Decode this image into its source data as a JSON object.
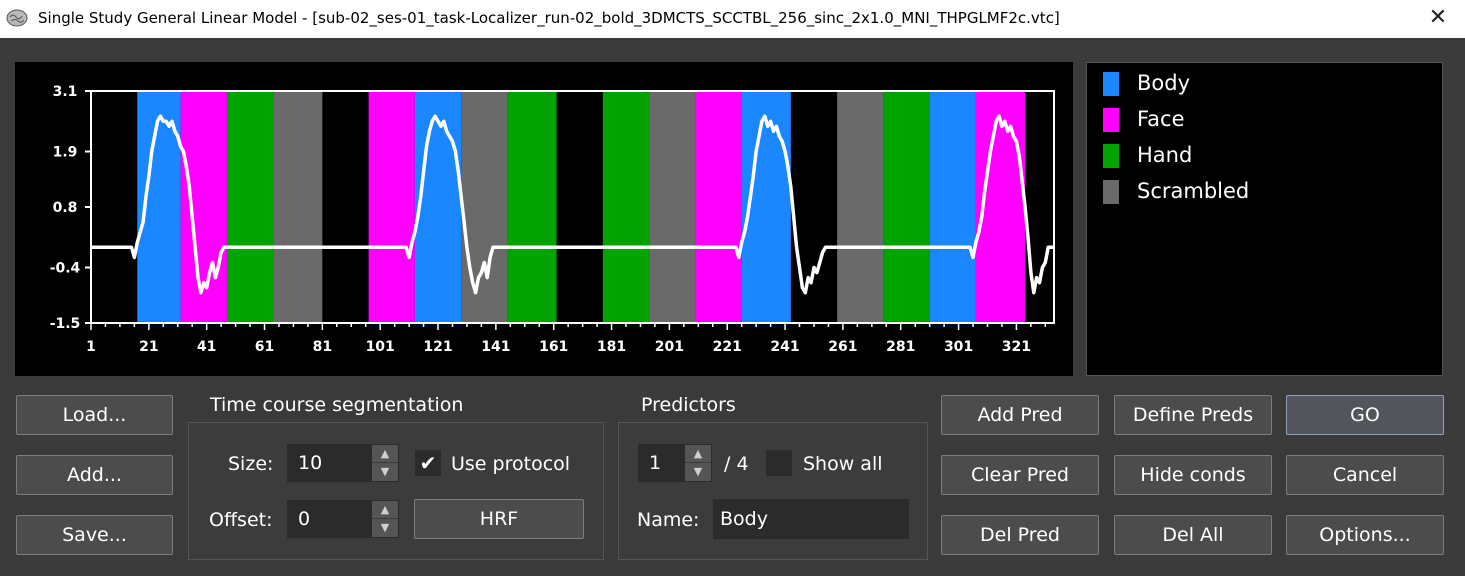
{
  "window": {
    "title": "Single Study General Linear Model - [sub-02_ses-01_task-Localizer_run-02_bold_3DMCTS_SCCTBL_256_sinc_2x1.0_MNI_THPGLMF2c.vtc]",
    "close_glyph": "✕"
  },
  "colors": {
    "Body": "#1a86ff",
    "Face": "#ff00ff",
    "Hand": "#00a300",
    "Scrambled": "#6a6a6a",
    "curve": "#ffffff"
  },
  "legend": [
    {
      "label": "Body",
      "color": "#1a86ff"
    },
    {
      "label": "Face",
      "color": "#ff00ff"
    },
    {
      "label": "Hand",
      "color": "#00a300"
    },
    {
      "label": "Scrambled",
      "color": "#6a6a6a"
    }
  ],
  "chart_data": {
    "type": "line",
    "xlim": [
      1,
      334
    ],
    "ylim": [
      -1.5,
      3.1
    ],
    "ytick_labels": [
      "3.1",
      "1.9",
      "0.8",
      "-0.4",
      "-1.5"
    ],
    "ytick_values": [
      3.1,
      1.9,
      0.8,
      -0.4,
      -1.5
    ],
    "xtick_labels": [
      "1",
      "21",
      "41",
      "61",
      "81",
      "101",
      "121",
      "141",
      "161",
      "181",
      "201",
      "221",
      "241",
      "261",
      "281",
      "301",
      "321"
    ],
    "xtick_values": [
      1,
      21,
      41,
      61,
      81,
      101,
      121,
      141,
      161,
      181,
      201,
      221,
      241,
      261,
      281,
      301,
      321
    ],
    "blocks": [
      {
        "cond": "Body",
        "start": 17,
        "end": 32
      },
      {
        "cond": "Face",
        "start": 32,
        "end": 48
      },
      {
        "cond": "Hand",
        "start": 48,
        "end": 64
      },
      {
        "cond": "Scrambled",
        "start": 64,
        "end": 81
      },
      {
        "cond": "Face",
        "start": 97,
        "end": 113
      },
      {
        "cond": "Body",
        "start": 113,
        "end": 129
      },
      {
        "cond": "Scrambled",
        "start": 129,
        "end": 145
      },
      {
        "cond": "Hand",
        "start": 145,
        "end": 162
      },
      {
        "cond": "Hand",
        "start": 178,
        "end": 194
      },
      {
        "cond": "Scrambled",
        "start": 194,
        "end": 210
      },
      {
        "cond": "Face",
        "start": 210,
        "end": 226
      },
      {
        "cond": "Body",
        "start": 226,
        "end": 243
      },
      {
        "cond": "Scrambled",
        "start": 259,
        "end": 275
      },
      {
        "cond": "Hand",
        "start": 275,
        "end": 291
      },
      {
        "cond": "Body",
        "start": 291,
        "end": 307
      },
      {
        "cond": "Face",
        "start": 307,
        "end": 324
      }
    ],
    "series": [
      {
        "x": [
          1,
          15,
          16,
          17,
          18,
          19,
          20,
          21,
          22,
          23,
          24,
          25,
          26,
          27,
          28,
          29,
          30,
          31,
          32,
          33,
          34,
          35,
          36,
          37,
          38,
          39,
          40,
          41,
          42,
          43,
          44,
          45,
          46,
          47,
          48,
          110,
          111,
          112,
          113,
          114,
          115,
          116,
          117,
          118,
          119,
          120,
          121,
          122,
          123,
          124,
          125,
          126,
          127,
          128,
          129,
          130,
          131,
          132,
          133,
          134,
          135,
          136,
          137,
          138,
          139,
          140,
          141,
          142,
          143,
          144,
          224,
          225,
          226,
          227,
          228,
          229,
          230,
          231,
          232,
          233,
          234,
          235,
          236,
          237,
          238,
          239,
          240,
          241,
          242,
          243,
          244,
          245,
          246,
          247,
          248,
          249,
          250,
          251,
          252,
          253,
          254,
          255,
          256,
          257,
          258,
          305,
          306,
          307,
          308,
          309,
          310,
          311,
          312,
          313,
          314,
          315,
          316,
          317,
          318,
          319,
          320,
          321,
          322,
          323,
          324,
          325,
          326,
          327,
          328,
          329,
          330,
          331,
          332,
          333,
          334
        ],
        "y": [
          0.0,
          0.0,
          -0.2,
          0.1,
          0.3,
          0.5,
          1.0,
          1.4,
          1.9,
          2.2,
          2.5,
          2.6,
          2.5,
          2.5,
          2.4,
          2.5,
          2.3,
          2.2,
          2.0,
          1.9,
          1.6,
          1.2,
          0.6,
          0.0,
          -0.6,
          -0.9,
          -0.7,
          -0.8,
          -0.5,
          -0.3,
          -0.6,
          -0.4,
          -0.1,
          0.0,
          0.0,
          0.0,
          -0.2,
          0.1,
          0.3,
          0.6,
          1.0,
          1.5,
          2.0,
          2.3,
          2.5,
          2.6,
          2.5,
          2.4,
          2.5,
          2.3,
          2.2,
          2.1,
          1.9,
          1.5,
          1.0,
          0.5,
          0.0,
          -0.4,
          -0.7,
          -0.9,
          -0.6,
          -0.5,
          -0.3,
          -0.6,
          -0.2,
          0.0,
          0.0,
          0.0,
          0.0,
          0.0,
          0.0,
          -0.2,
          0.1,
          0.3,
          0.6,
          1.0,
          1.4,
          1.9,
          2.2,
          2.5,
          2.6,
          2.4,
          2.5,
          2.3,
          2.4,
          2.2,
          2.1,
          1.9,
          1.6,
          1.2,
          0.6,
          0.0,
          -0.4,
          -0.8,
          -0.9,
          -0.6,
          -0.7,
          -0.4,
          -0.5,
          -0.3,
          -0.1,
          0.0,
          0.0,
          0.0,
          0.0,
          0.0,
          -0.2,
          0.1,
          0.3,
          0.6,
          1.1,
          1.5,
          1.9,
          2.2,
          2.5,
          2.6,
          2.4,
          2.5,
          2.3,
          2.4,
          2.2,
          2.1,
          1.8,
          1.3,
          0.8,
          0.2,
          -0.5,
          -0.9,
          -0.6,
          -0.7,
          -0.4,
          -0.3,
          0.0,
          0.0,
          0.0
        ]
      }
    ]
  },
  "buttons": {
    "load": "Load...",
    "add": "Add...",
    "save": "Save...",
    "hrf": "HRF",
    "add_pred": "Add Pred",
    "clear_pred": "Clear Pred",
    "del_pred": "Del Pred",
    "define_preds": "Define Preds",
    "hide_conds": "Hide conds",
    "del_all": "Del All",
    "go": "GO",
    "cancel": "Cancel",
    "options": "Options..."
  },
  "segmentation": {
    "title": "Time course segmentation",
    "size_label": "Size:",
    "size_value": "10",
    "offset_label": "Offset:",
    "offset_value": "0",
    "use_protocol_label": "Use protocol",
    "use_protocol_checked": "✔"
  },
  "predictors": {
    "title": "Predictors",
    "index_value": "1",
    "total": "/ 4",
    "show_all_label": "Show all",
    "name_label": "Name:",
    "name_value": "Body"
  }
}
